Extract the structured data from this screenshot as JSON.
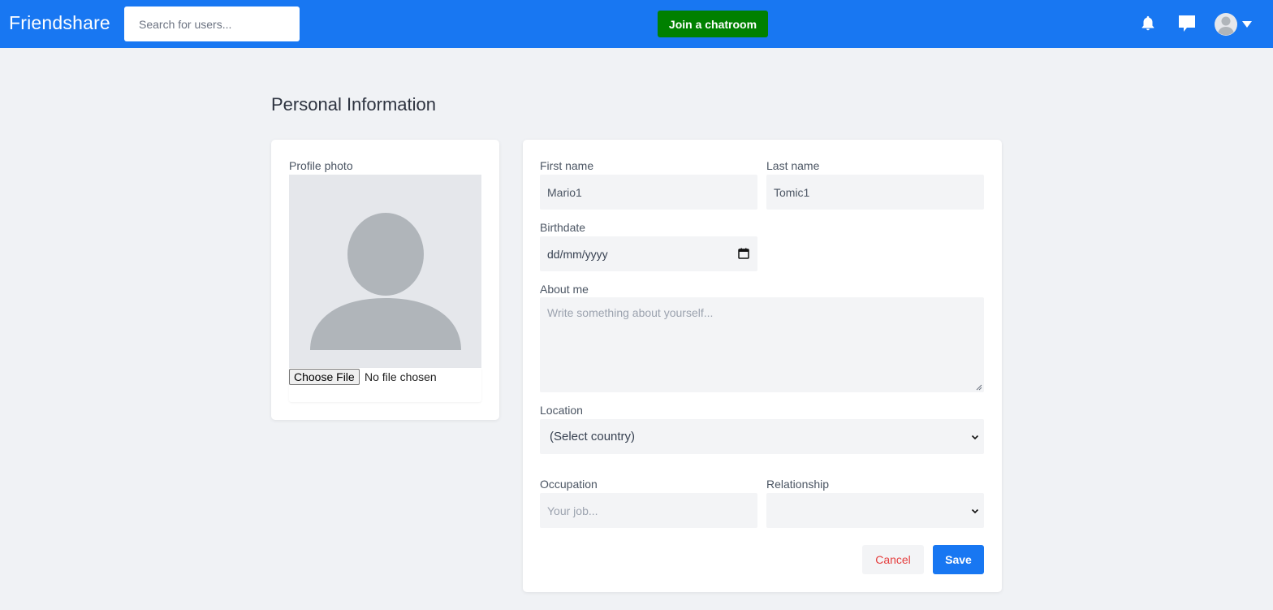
{
  "app": {
    "brand": "Friendshare"
  },
  "navbar": {
    "search_placeholder": "Search for users...",
    "join_button": "Join a chatroom",
    "icons": [
      "bell-icon",
      "chat-icon",
      "avatar-icon",
      "caret-down-icon"
    ]
  },
  "page": {
    "title": "Personal Information"
  },
  "photo": {
    "label": "Profile photo",
    "choose_file_label": "Choose File",
    "file_status": "No file chosen"
  },
  "form": {
    "first_name": {
      "label": "First name",
      "value": "Mario1"
    },
    "last_name": {
      "label": "Last name",
      "value": "Tomic1"
    },
    "birthdate": {
      "label": "Birthdate",
      "placeholder": "dd/mm/yyyy"
    },
    "about": {
      "label": "About me",
      "placeholder": "Write something about yourself..."
    },
    "location": {
      "label": "Location",
      "value": "(Select country)"
    },
    "occupation": {
      "label": "Occupation",
      "placeholder": "Your job..."
    },
    "relationship": {
      "label": "Relationship",
      "value": ""
    },
    "cancel_label": "Cancel",
    "save_label": "Save"
  },
  "colors": {
    "primary": "#1877f2",
    "join_green": "#008000",
    "cancel_red": "#e53e3e",
    "background": "#f0f2f5"
  }
}
